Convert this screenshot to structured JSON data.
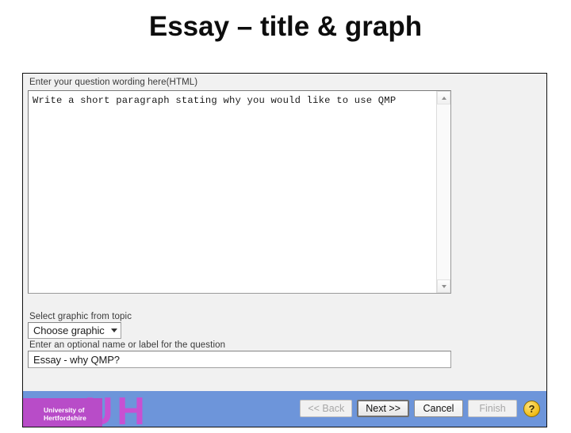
{
  "slide": {
    "title": "Essay – title & graph"
  },
  "dialog": {
    "question": {
      "label": "Enter your question wording here(HTML)",
      "value": "Write a short paragraph stating why you would like to use QMP"
    },
    "graphic": {
      "label": "Select graphic from topic",
      "selected": "Choose graphic",
      "caret_icon": "chevron-down-icon"
    },
    "name": {
      "label": "Enter an optional name or label for the question",
      "value": "Essay - why QMP?"
    },
    "scrollbar": {
      "up_icon": "scroll-up-arrow-icon",
      "down_icon": "scroll-down-arrow-icon"
    },
    "footer": {
      "buttons": [
        {
          "label": "<< Back",
          "state": "disabled"
        },
        {
          "label": "Next >>",
          "state": "default"
        },
        {
          "label": "Cancel",
          "state": "enabled"
        },
        {
          "label": "Finish",
          "state": "disabled"
        }
      ],
      "help": {
        "label": "?",
        "icon": "help-question-icon"
      }
    }
  },
  "branding": {
    "logo_letters": "UH",
    "line1": "University of",
    "line2": "Hertfordshire",
    "magenta": "#b84cc8",
    "letters_color": "#c850d2",
    "footer_blue": "#6d95da"
  }
}
